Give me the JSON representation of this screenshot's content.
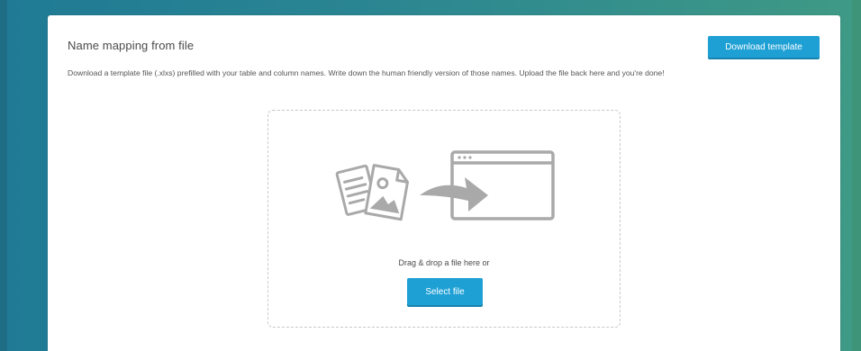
{
  "panel": {
    "title": "Name mapping from file",
    "download_button_label": "Download template",
    "description": "Download a template file (.xlxs) prefilled with your table and column names. Write down the human friendly version of those names. Upload the file back here and you're done!"
  },
  "dropzone": {
    "prompt": "Drag & drop a file here or",
    "select_button_label": "Select file",
    "icons": [
      "document-image-icon",
      "arrow-right-icon",
      "browser-window-icon"
    ]
  },
  "colors": {
    "accent": "#1ea0d5",
    "background_left": "#1f7a95",
    "background_right": "#3f9a85",
    "icon_gray": "#a9a9a9"
  }
}
